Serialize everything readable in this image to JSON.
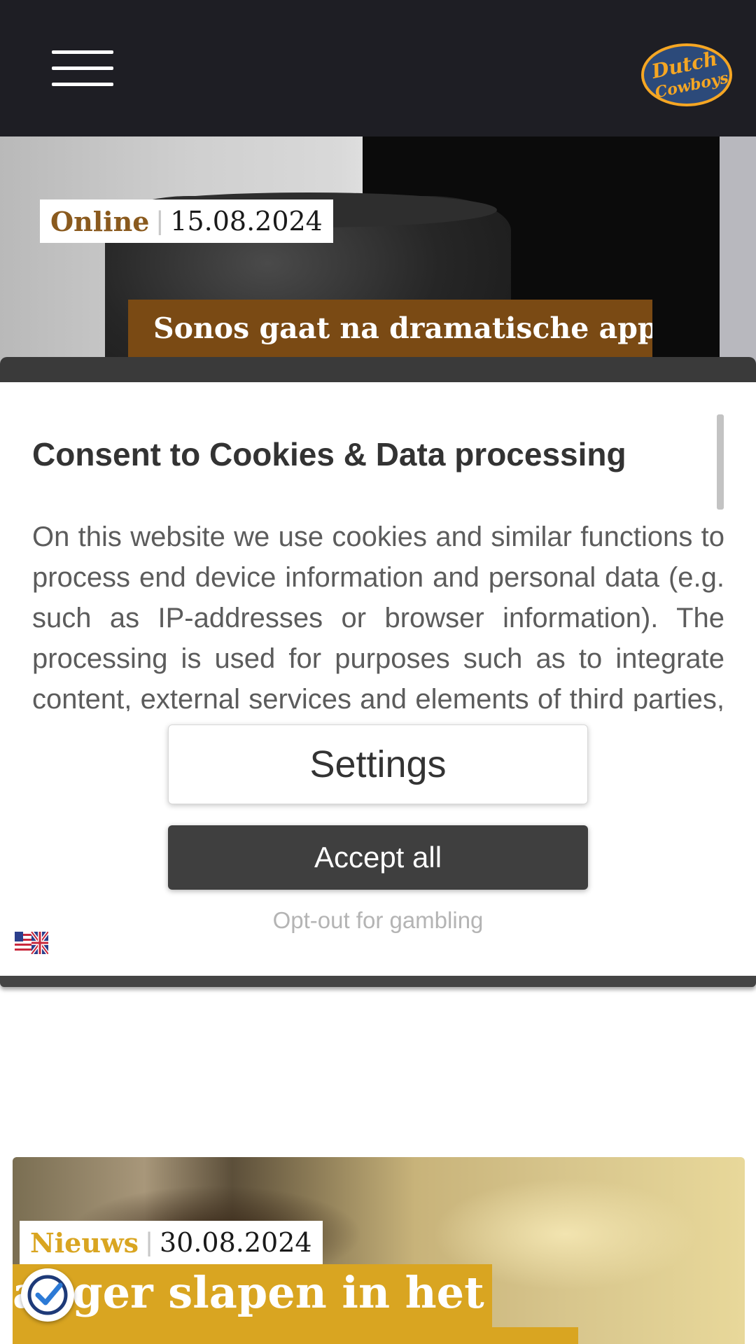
{
  "header": {
    "menu_icon": "hamburger-menu-icon",
    "logo_text": "Dutch Cowboys",
    "colors": {
      "background": "#1e1e24",
      "logo_orange": "#f5a623",
      "logo_blue": "#2c4a7a"
    }
  },
  "articles": [
    {
      "category": "Online",
      "separator": "|",
      "date": "15.08.2024",
      "title": "Sonos gaat na dramatische app-"
    },
    {
      "category": "Nieuws",
      "separator": "|",
      "date": "30.08.2024",
      "title": "anger slapen in het"
    }
  ],
  "cookie_modal": {
    "title": "Consent to Cookies & Data processing",
    "body": "On this website we use cookies and similar functions to process end device information and personal data (e.g. such as IP-addresses or browser information). The processing is used for purposes such as to integrate content, external services and elements of third parties, statistical analysis/measurement, personalized advertising and the integration of social media.",
    "settings_label": "Settings",
    "accept_label": "Accept all",
    "optout_label": "Opt-out for gambling",
    "language_icon": "uk-flag-icon"
  },
  "trust_badge_icon": "checkmark-badge-icon",
  "colors": {
    "category_online": "#8a5a1e",
    "category_nieuws": "#d9a521",
    "title_box_brown": "#7a4a14",
    "title_box_gold": "#d9a521",
    "accept_button": "#3f3f3f"
  }
}
